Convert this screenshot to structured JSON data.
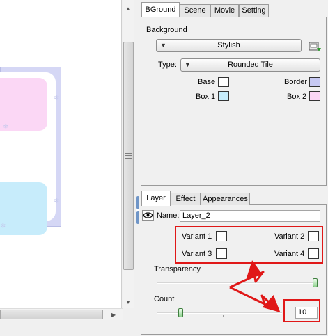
{
  "top_tabs": [
    "BGround",
    "Scene",
    "Movie",
    "Setting"
  ],
  "background": {
    "section_label": "Background",
    "style_value": "Stylish",
    "type_label": "Type:",
    "type_value": "Rounded Tile",
    "swatches": {
      "base_label": "Base",
      "base_color": "#ffffff",
      "border_label": "Border",
      "border_color": "#c7c9f3",
      "box1_label": "Box 1",
      "box1_color": "#c6ecfb",
      "box2_label": "Box 2",
      "box2_color": "#fbd6f5"
    }
  },
  "bottom_tabs": [
    "Layer",
    "Effect",
    "Appearances"
  ],
  "layer": {
    "visibility_icon": "eye-icon",
    "name_label": "Name:",
    "name_value": "Layer_2",
    "variants": [
      "Variant 1",
      "Variant 2",
      "Variant 3",
      "Variant 4"
    ],
    "transparency_label": "Transparency",
    "transparency_value": 1.0,
    "count_label": "Count",
    "count_value": "10"
  },
  "colors": {
    "annotation_red": "#e01818",
    "splitter_blue": "#6f95c7"
  }
}
